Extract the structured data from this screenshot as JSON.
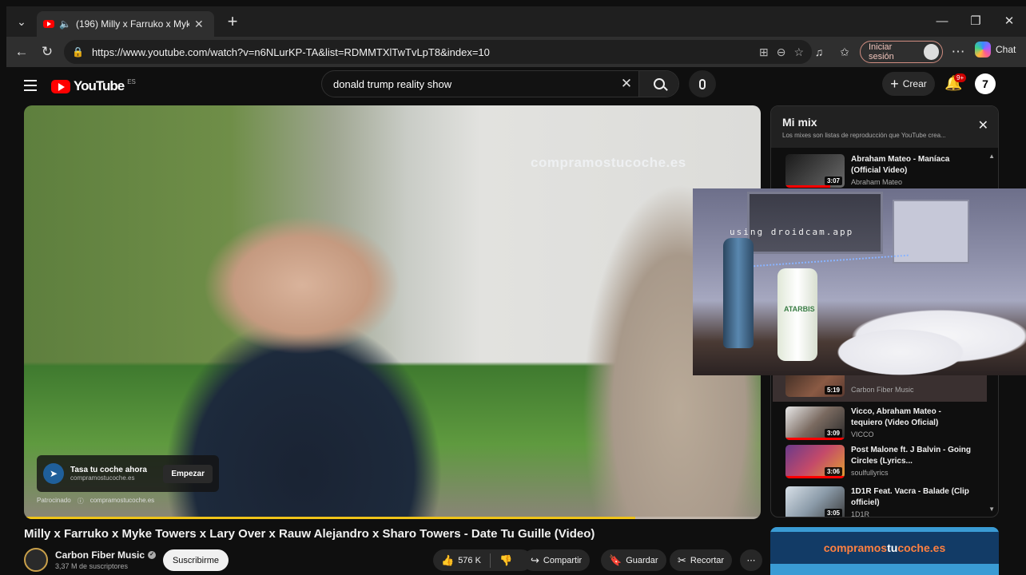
{
  "browser": {
    "tab_title": "(196) Milly x Farruko x Myke T",
    "url": "https://www.youtube.com/watch?v=n6NLurKP-TA&list=RDMMTXlTwTvLpT8&index=10",
    "signin_label": "Iniciar sesión",
    "copilot_label": "Chat"
  },
  "youtube": {
    "logo_text": "YouTube",
    "country_code": "ES",
    "search_query": "donald trump reality show",
    "create_label": "Crear",
    "notification_count": "9+"
  },
  "player": {
    "watermark": "compramostucoche.es",
    "ad_title": "Tasa tu coche ahora",
    "ad_domain": "compramostucoche.es",
    "ad_cta": "Empezar",
    "ad_sponsored": "Patrocinado",
    "ad_footer_domain": "compramostucoche.es",
    "progress": 0.83
  },
  "video": {
    "title": "Milly x Farruko x Myke Towers x Lary Over x Rauw Alejandro x Sharo Towers - Date Tu Guille (Video)",
    "channel": "Carbon Fiber Music",
    "subscribers": "3,37 M de suscriptores",
    "subscribe_label": "Suscribirme",
    "likes": "576 K",
    "share_label": "Compartir",
    "save_label": "Guardar",
    "clip_label": "Recortar"
  },
  "mix": {
    "title": "Mi mix",
    "description": "Los mixes son listas de reproducción que YouTube crea...",
    "items": [
      {
        "title": "Abraham Mateo - Maníaca (Official Video)",
        "channel": "Abraham Mateo",
        "duration": "3:07"
      },
      {
        "title": "",
        "channel": "Carbon Fiber Music",
        "duration": "5:19"
      },
      {
        "title": "Vicco, Abraham Mateo - tequiero (Video Oficial)",
        "channel": "VICCO",
        "duration": "3:09"
      },
      {
        "title": "Post Malone ft. J Balvin - Going Circles (Lyrics...",
        "channel": "soulfullyrics",
        "duration": "3:06"
      },
      {
        "title": "1D1R Feat. Vacra - Balade (Clip officiel)",
        "channel": "1D1R",
        "duration": "3:05"
      }
    ]
  },
  "banner": {
    "part1": "compramos",
    "part2": "tu",
    "part3": "coche.es"
  },
  "overlay": {
    "text": "using droidcam.app",
    "lotion_label": "ATARBIS"
  }
}
